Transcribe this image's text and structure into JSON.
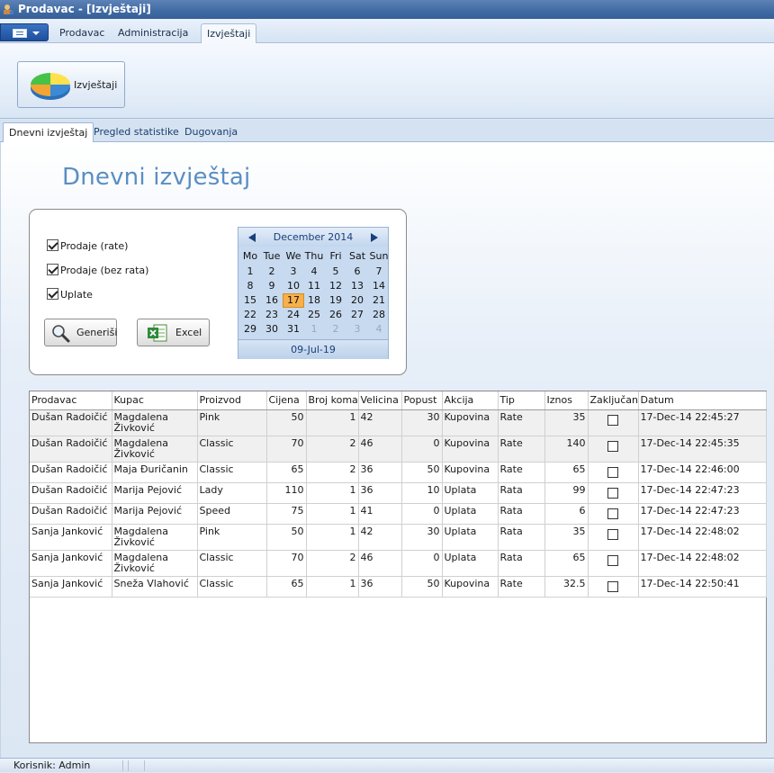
{
  "window": {
    "title": "Prodavac - [Izvještaji]"
  },
  "ribbon": {
    "tabs": [
      "Prodavac",
      "Administracija",
      "Izvještaji"
    ],
    "active_tab": "Izvještaji",
    "reports_button": "Izvještaji"
  },
  "doc_tabs": [
    "Dnevni izvještaj",
    "Pregled statistike",
    "Dugovanja"
  ],
  "page": {
    "title": "Dnevni izvještaj",
    "checkboxes": [
      {
        "label": "Prodaje (rate)",
        "checked": true
      },
      {
        "label": "Prodaje (bez rata)",
        "checked": true
      },
      {
        "label": "Uplate",
        "checked": true
      }
    ],
    "generate_button": "Generiši",
    "excel_button": "Excel"
  },
  "calendar": {
    "month_label": "December 2014",
    "weekdays": [
      "Mo",
      "Tue",
      "We",
      "Thu",
      "Fri",
      "Sat",
      "Sun"
    ],
    "weeks": [
      [
        "1",
        "2",
        "3",
        "4",
        "5",
        "6",
        "7"
      ],
      [
        "8",
        "9",
        "10",
        "11",
        "12",
        "13",
        "14"
      ],
      [
        "15",
        "16",
        "17",
        "18",
        "19",
        "20",
        "21"
      ],
      [
        "22",
        "23",
        "24",
        "25",
        "26",
        "27",
        "28"
      ],
      [
        "29",
        "30",
        "31",
        "1",
        "2",
        "3",
        "4"
      ]
    ],
    "selected_day": "17",
    "today_label": "09-Jul-19"
  },
  "table": {
    "columns": [
      "Prodavac",
      "Kupac",
      "Proizvod",
      "Cijena",
      "Broj komad",
      "Velicina",
      "Popust",
      "Akcija",
      "Tip",
      "Iznos",
      "Zaključano",
      "Datum"
    ],
    "rows": [
      [
        "Dušan Radoičić",
        "Magdalena Živković",
        "Pink",
        "50",
        "1",
        "42",
        "30",
        "Kupovina",
        "Rate",
        "35",
        false,
        "17-Dec-14 22:45:27"
      ],
      [
        "Dušan Radoičić",
        "Magdalena Živković",
        "Classic",
        "70",
        "2",
        "46",
        "0",
        "Kupovina",
        "Rate",
        "140",
        false,
        "17-Dec-14 22:45:35"
      ],
      [
        "Dušan Radoičić",
        "Maja Đuričanin",
        "Classic",
        "65",
        "2",
        "36",
        "50",
        "Kupovina",
        "Rate",
        "65",
        false,
        "17-Dec-14 22:46:00"
      ],
      [
        "Dušan Radoičić",
        "Marija Pejović",
        "Lady",
        "110",
        "1",
        "36",
        "10",
        "Uplata",
        "Rata",
        "99",
        false,
        "17-Dec-14 22:47:23"
      ],
      [
        "Dušan Radoičić",
        "Marija Pejović",
        "Speed",
        "75",
        "1",
        "41",
        "0",
        "Uplata",
        "Rata",
        "6",
        false,
        "17-Dec-14 22:47:23"
      ],
      [
        "Sanja Janković",
        "Magdalena Živković",
        "Pink",
        "50",
        "1",
        "42",
        "30",
        "Uplata",
        "Rata",
        "35",
        false,
        "17-Dec-14 22:48:02"
      ],
      [
        "Sanja Janković",
        "Magdalena Živković",
        "Classic",
        "70",
        "2",
        "46",
        "0",
        "Uplata",
        "Rata",
        "65",
        false,
        "17-Dec-14 22:48:02"
      ],
      [
        "Sanja Janković",
        "Sneža Vlahović",
        "Classic",
        "65",
        "1",
        "36",
        "50",
        "Kupovina",
        "Rate",
        "32.5",
        false,
        "17-Dec-14 22:50:41"
      ]
    ]
  },
  "status": {
    "user": "Korisnik: Admin"
  },
  "colors": {
    "accent": "#5a8ec3",
    "today": "#f7b04b",
    "titlebar": "#3f6aa3"
  }
}
